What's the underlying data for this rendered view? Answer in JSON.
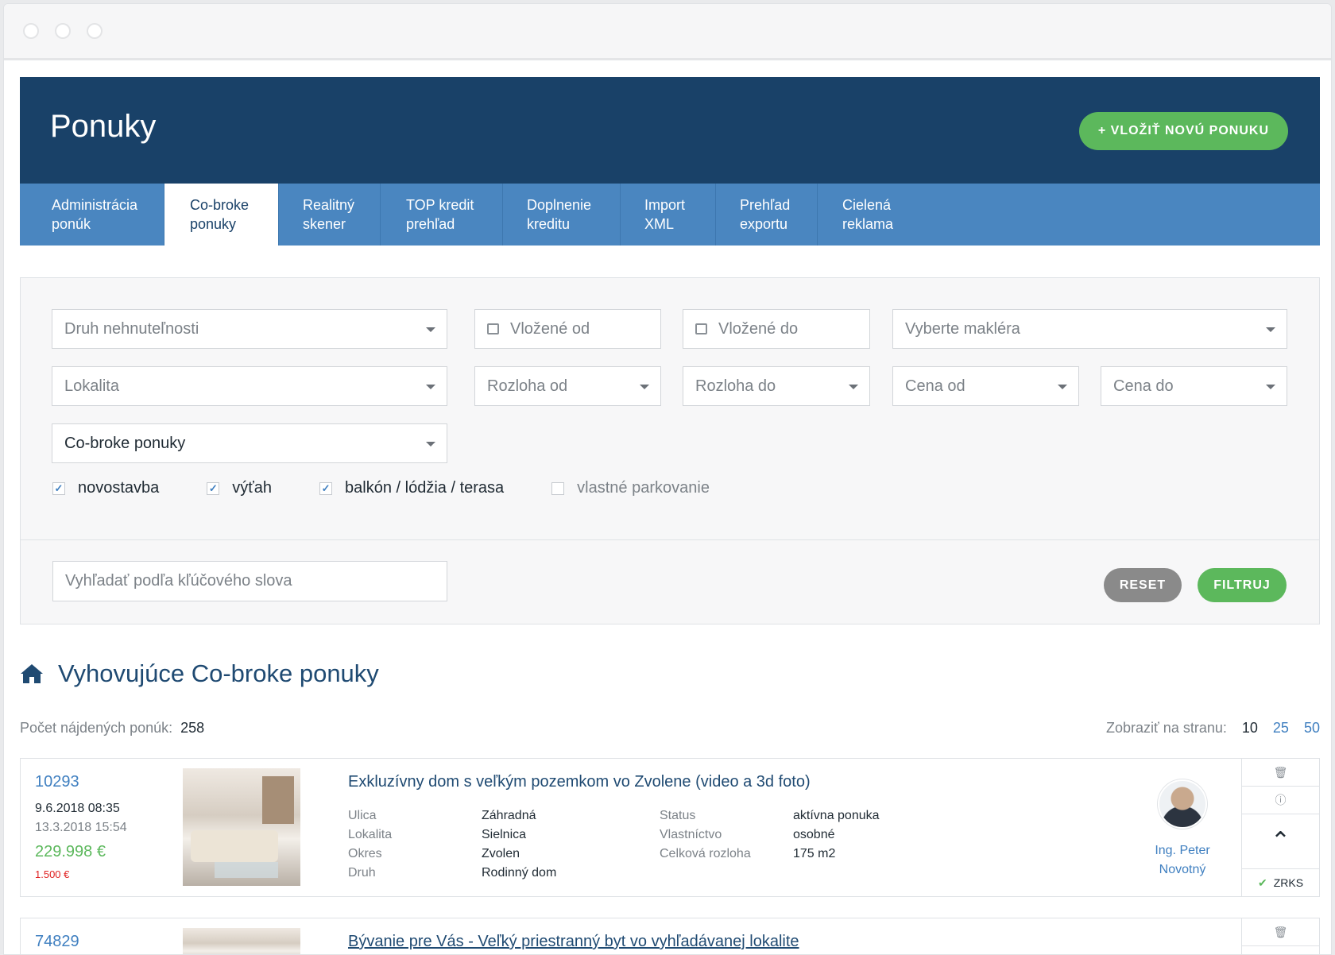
{
  "header": {
    "title": "Ponuky",
    "add_button": "+ VLOŽIŤ NOVÚ PONUKU"
  },
  "tabs": [
    {
      "label": "Administrácia\nponúk"
    },
    {
      "label": "Co-broke\nponuky",
      "active": true
    },
    {
      "label": "Realitný\nskener"
    },
    {
      "label": "TOP kredit\nprehľad"
    },
    {
      "label": "Doplnenie\nkreditu"
    },
    {
      "label": "Import\nXML"
    },
    {
      "label": "Prehľad\nexportu"
    },
    {
      "label": "Cielená\nreklama"
    }
  ],
  "filters": {
    "property_type": "Druh nehnuteľnosti",
    "inserted_from": "Vložené od",
    "inserted_to": "Vložené do",
    "broker": "Vyberte makléra",
    "locality": "Lokalita",
    "area_from": "Rozloha od",
    "area_to": "Rozloha do",
    "price_from": "Cena od",
    "price_to": "Cena do",
    "offer_type": "Co-broke ponuky",
    "checkboxes": [
      {
        "label": "novostavba",
        "checked": true
      },
      {
        "label": "výťah",
        "checked": true
      },
      {
        "label": "balkón / lódžia / terasa",
        "checked": true
      },
      {
        "label": "vlastné parkovanie",
        "checked": false
      }
    ],
    "keyword_placeholder": "Vyhľadať podľa kľúčového slova",
    "reset": "RESET",
    "filter": "FILTRUJ"
  },
  "results": {
    "title": "Vyhovujúce Co-broke ponuky",
    "count_label": "Počet nájdených ponúk:",
    "count": "258",
    "per_page_label": "Zobraziť na stranu:",
    "per_page_options": [
      "10",
      "25",
      "50"
    ],
    "per_page_selected": "10"
  },
  "listings": [
    {
      "id": "10293",
      "date_created": "9.6.2018 08:35",
      "date_updated": "13.3.2018 15:54",
      "price": "229.998 €",
      "fee": "1.500 €",
      "title": "Exkluzívny dom s veľkým pozemkom vo Zvolene (video a 3d foto)",
      "attrs": {
        "street_label": "Ulica",
        "street": "Záhradná",
        "status_label": "Status",
        "status": "aktívna ponuka",
        "locality_label": "Lokalita",
        "locality": "Sielnica",
        "ownership_label": "Vlastníctvo",
        "ownership": "osobné",
        "district_label": "Okres",
        "district": "Zvolen",
        "area_label": "Celková rozloha",
        "area": "175 m2",
        "type_label": "Druh",
        "type": "Rodinný dom"
      },
      "agent": "Ing. Peter\nNovotný",
      "badge": "ZRKS"
    },
    {
      "id": "74829",
      "title": "Bývanie pre Vás - Veľký priestranný byt vo vyhľadávanej lokalite"
    }
  ],
  "icons": {
    "home": "home-icon",
    "calendar": "calendar-icon",
    "trash": "trash-icon",
    "info": "info-icon",
    "top": "chevron-up-icon",
    "check": "check-icon"
  },
  "colors": {
    "primary": "#194168",
    "tabs": "#4a86c0",
    "accent": "#5cb85c",
    "danger": "#e02020"
  }
}
